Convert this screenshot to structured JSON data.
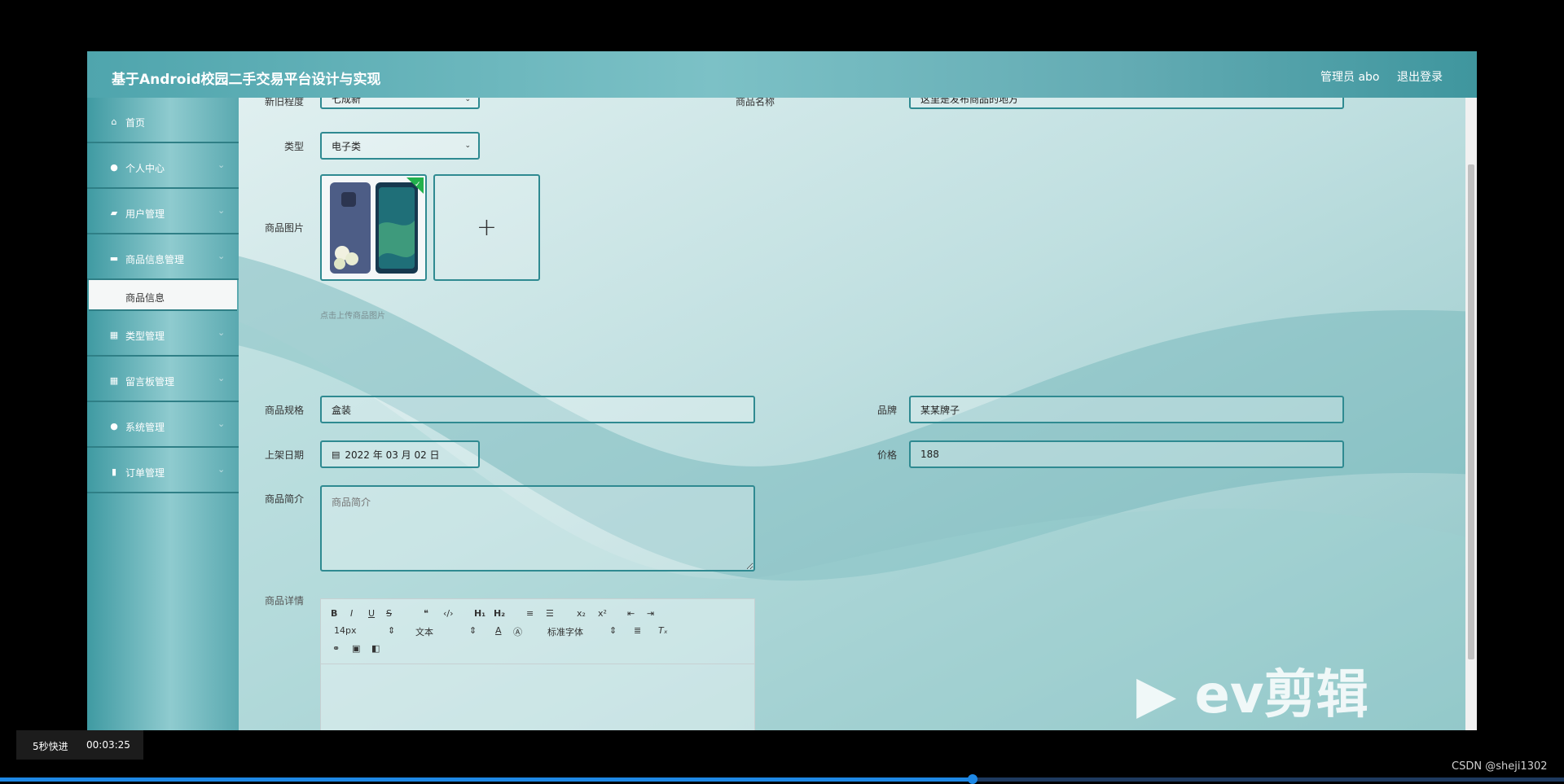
{
  "header": {
    "title": "基于Android校园二手交易平台设计与实现",
    "admin": "管理员 abo",
    "logout": "退出登录"
  },
  "sidebar": {
    "items": [
      {
        "label": "首页",
        "icon": "home-icon"
      },
      {
        "label": "个人中心",
        "icon": "user-icon"
      },
      {
        "label": "用户管理",
        "icon": "users-icon"
      },
      {
        "label": "商品信息管理",
        "icon": "briefcase-icon"
      },
      {
        "label": "类型管理",
        "icon": "grid-icon"
      },
      {
        "label": "留言板管理",
        "icon": "grid-icon"
      },
      {
        "label": "系统管理",
        "icon": "user-icon"
      },
      {
        "label": "订单管理",
        "icon": "bar-chart-icon"
      }
    ],
    "active_sub": "商品信息"
  },
  "form": {
    "condition_label": "新旧程度",
    "condition_value": "七成新",
    "name_label": "商品名称",
    "name_value": "这里是发布商品的地方",
    "type_label": "类型",
    "type_value": "电子类",
    "image_label": "商品图片",
    "upload_hint": "点击上传商品图片",
    "spec_label": "商品规格",
    "spec_value": "盒装",
    "brand_label": "品牌",
    "brand_value": "某某牌子",
    "date_label": "上架日期",
    "date_value": "2022 年 03 月 02 日",
    "price_label": "价格",
    "price_value": "188",
    "intro_label": "商品简介",
    "intro_placeholder": "商品简介",
    "detail_label": "商品详情"
  },
  "editor_toolbar": {
    "font_size": "14px",
    "text_style": "文本",
    "font_family": "标准字体"
  },
  "video": {
    "speed_label": "5秒快进",
    "time": "00:03:25",
    "progress": 0.622
  },
  "credit": "CSDN @sheji1302",
  "watermark": "ev剪辑",
  "colors": {
    "accent": "#2f8a91",
    "sidebar": "#4fa5ad"
  }
}
